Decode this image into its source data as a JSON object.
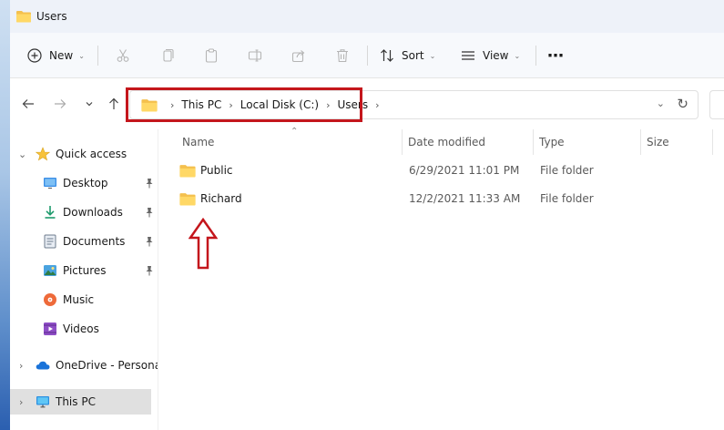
{
  "window": {
    "title": "Users"
  },
  "toolbar": {
    "new_label": "New",
    "sort_label": "Sort",
    "view_label": "View",
    "more_label": "⋯"
  },
  "address": {
    "crumbs": [
      "This PC",
      "Local Disk (C:)",
      "Users"
    ]
  },
  "sidebar": {
    "quick_access": "Quick access",
    "items": [
      {
        "label": "Desktop",
        "icon": "desktop-icon",
        "pinned": true
      },
      {
        "label": "Downloads",
        "icon": "downloads-icon",
        "pinned": true
      },
      {
        "label": "Documents",
        "icon": "documents-icon",
        "pinned": true
      },
      {
        "label": "Pictures",
        "icon": "pictures-icon",
        "pinned": true
      },
      {
        "label": "Music",
        "icon": "music-icon",
        "pinned": false
      },
      {
        "label": "Videos",
        "icon": "videos-icon",
        "pinned": false
      }
    ],
    "onedrive": "OneDrive - Personal",
    "this_pc": "This PC"
  },
  "columns": {
    "name": "Name",
    "date": "Date modified",
    "type": "Type",
    "size": "Size"
  },
  "files": [
    {
      "name": "Public",
      "date": "6/29/2021 11:01 PM",
      "type": "File folder"
    },
    {
      "name": "Richard",
      "date": "12/2/2021 11:33 AM",
      "type": "File folder"
    }
  ],
  "colors": {
    "annotation": "#c4161c",
    "folder": "#f4c04e",
    "selected": "#e0e0e0"
  }
}
